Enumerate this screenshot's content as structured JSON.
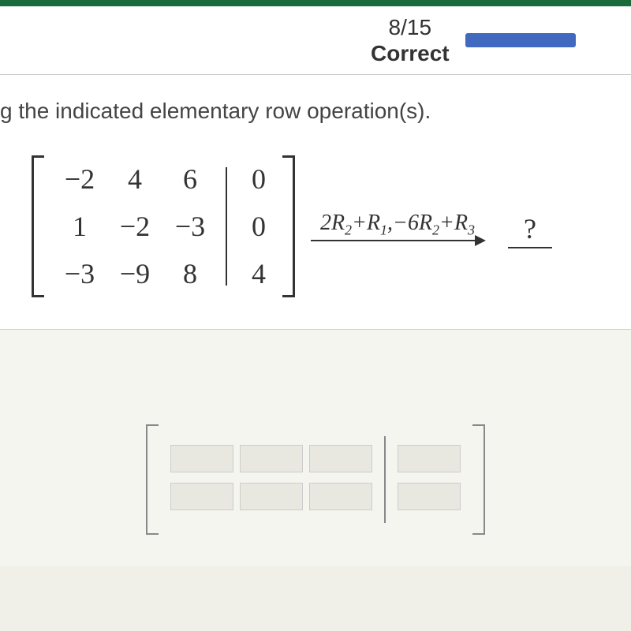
{
  "header": {
    "score": "8/15",
    "status": "Correct"
  },
  "question": {
    "text": "g the indicated elementary row operation(s)."
  },
  "matrix": {
    "left": [
      [
        "−2",
        "4",
        "6"
      ],
      [
        "1",
        "−2",
        "−3"
      ],
      [
        "−3",
        "−9",
        "8"
      ]
    ],
    "right": [
      "0",
      "0",
      "4"
    ]
  },
  "operation": {
    "label_parts": {
      "part1": "2R",
      "sub1": "2",
      "part2": "+R",
      "sub2": "1",
      "part3": ",−6R",
      "sub3": "2",
      "part4": "+R",
      "sub4": "3"
    }
  },
  "result": {
    "placeholder": "?"
  }
}
